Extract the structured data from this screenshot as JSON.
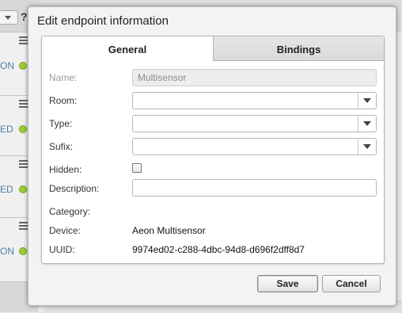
{
  "background": {
    "help_mark": "?",
    "cards": [
      {
        "state": "ON"
      },
      {
        "state": "ED"
      },
      {
        "state": "ED"
      },
      {
        "state": "ON"
      }
    ]
  },
  "dialog": {
    "title": "Edit endpoint information",
    "tabs": [
      {
        "label": "General",
        "active": true
      },
      {
        "label": "Bindings",
        "active": false
      }
    ],
    "fields": {
      "name": {
        "label": "Name:",
        "value": "Multisensor"
      },
      "room": {
        "label": "Room:",
        "value": ""
      },
      "type": {
        "label": "Type:",
        "value": ""
      },
      "sufix": {
        "label": "Sufix:",
        "value": ""
      },
      "hidden": {
        "label": "Hidden:",
        "checked": false
      },
      "description": {
        "label": "Description:",
        "value": ""
      },
      "category": {
        "label": "Category:",
        "value": ""
      },
      "device": {
        "label": "Device:",
        "value": "Aeon Multisensor"
      },
      "uuid": {
        "label": "UUID:",
        "value": "9974ed02-c288-4dbc-94d8-d696f2dff8d7"
      }
    },
    "buttons": {
      "save": "Save",
      "cancel": "Cancel"
    }
  },
  "colors": {
    "status_dot": "#9acd32",
    "state_text": "#4a7fa7"
  }
}
